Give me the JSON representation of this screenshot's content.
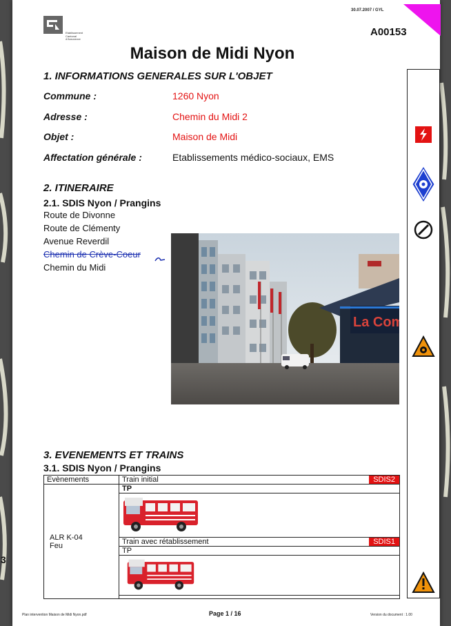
{
  "header": {
    "logo_lines": [
      "Etablissement",
      "Cantonal",
      "d'Assurance"
    ],
    "date_author": "30.07.2007 / GYL",
    "doc_code": "A00153",
    "corner_color": "#ee14ee"
  },
  "title": "Maison de Midi Nyon",
  "section1": {
    "heading": "1. INFORMATIONS GENERALES SUR L'OBJET",
    "rows": [
      {
        "label": "Commune :",
        "value": "1260 Nyon",
        "red": true
      },
      {
        "label": "Adresse :",
        "value": "Chemin du Midi 2",
        "red": true
      },
      {
        "label": "Objet :",
        "value": "Maison de Midi",
        "red": true
      },
      {
        "label": "Affectation générale :",
        "value": "Etablissements médico-sociaux, EMS",
        "red": false
      }
    ]
  },
  "section2": {
    "heading": "2. ITINERAIRE",
    "subheading": "2.1. SDIS Nyon / Prangins",
    "routes": [
      "Route de Divonne",
      "Route de Clémenty",
      "Avenue Reverdil",
      "Chemin de Crève-Coeur",
      "Chemin du Midi"
    ]
  },
  "photo": {
    "sign_text": "La Com"
  },
  "section3": {
    "heading": "3. EVENEMENTS ET TRAINS",
    "subheading": "3.1. SDIS Nyon / Prangins",
    "col_header": "Evènements",
    "event_code": "ALR K-04",
    "event_type": "Feu",
    "trains": [
      {
        "label": "Train initial",
        "sdis": "SDIS2",
        "vehicle": "TP"
      },
      {
        "label": "Train avec rétablissement",
        "sdis": "SDIS1",
        "vehicle": "TP"
      }
    ]
  },
  "sidebar_icons": [
    "electric-hazard-icon",
    "sprinkler-icon",
    "gas-valve-icon",
    "hazard-triangle-icon",
    "warning-triangle-icon"
  ],
  "footer": {
    "left": "Plan intervention Maison de Midi Nyon.pdf",
    "center": "Page 1 / 16",
    "right": "Version du document : 1.00"
  },
  "edge_fragment": "3",
  "colors": {
    "accent_red": "#e31212",
    "magenta": "#ee14ee",
    "sidebar_blue": "#1d3fd0",
    "hazard_orange": "#f0920a"
  }
}
